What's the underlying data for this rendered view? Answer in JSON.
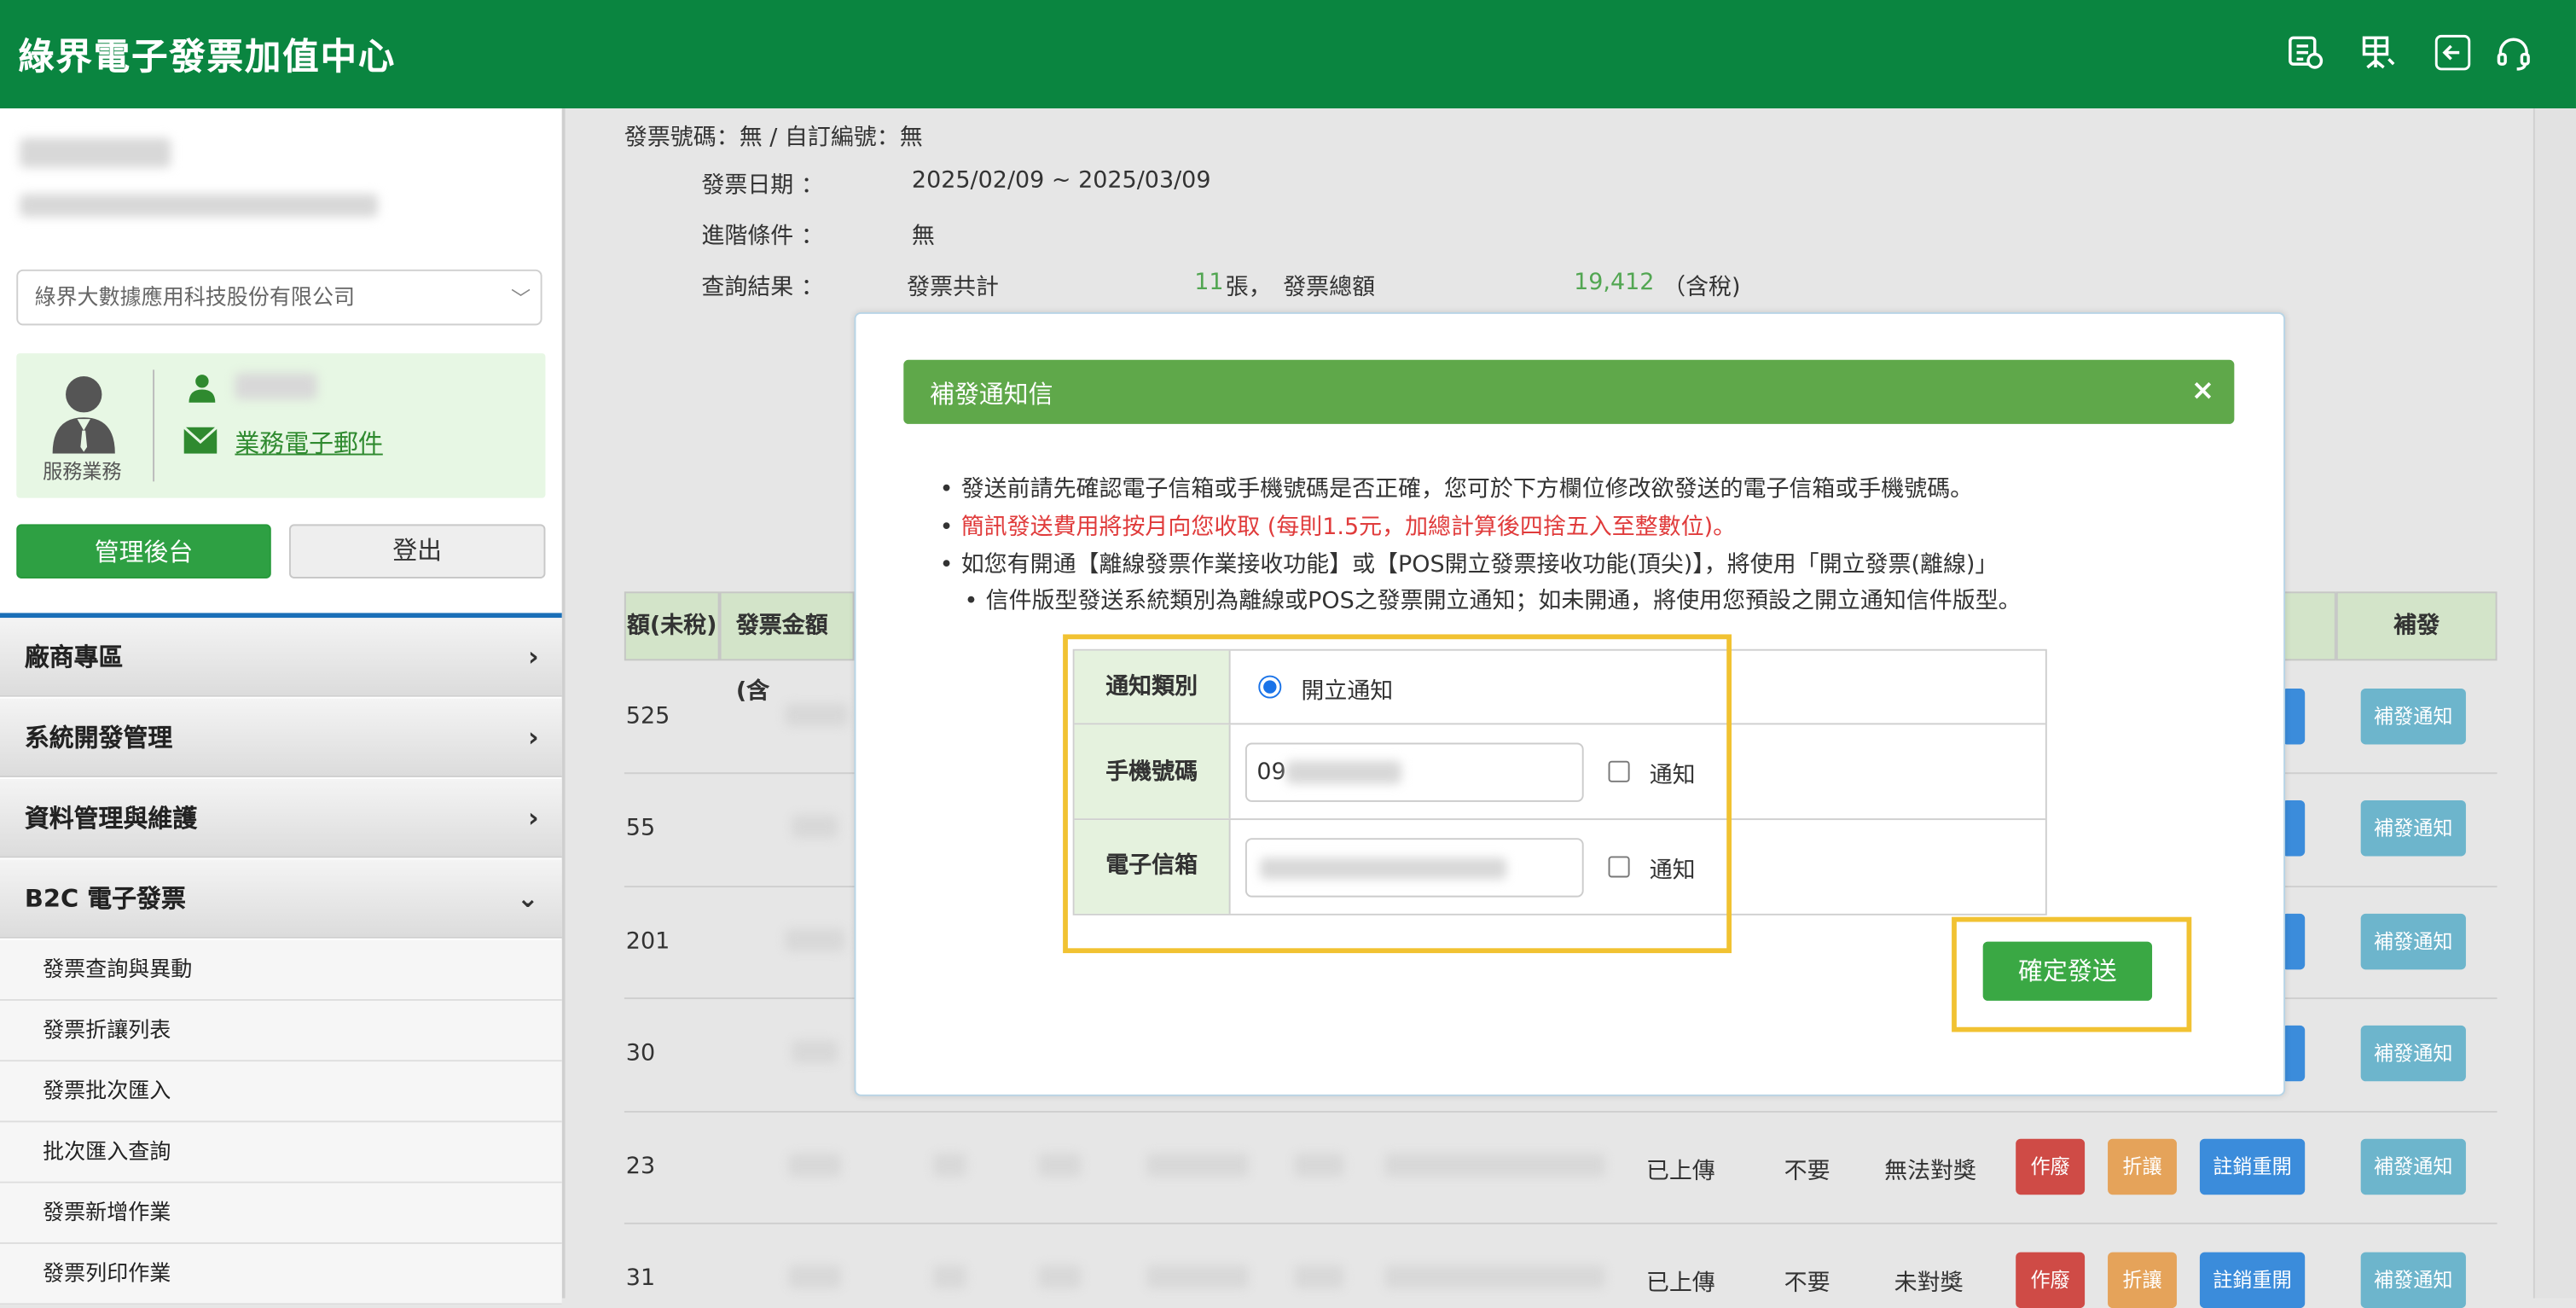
{
  "app": {
    "title": "綠界電子發票加值中心",
    "header_icons": [
      "invoice-chat-icon",
      "font-size-icon",
      "back-arrow-icon",
      "headset-icon"
    ]
  },
  "sidebar": {
    "company_select_value": "綠界大數據應用科技股份有限公司",
    "agent_role": "服務業務",
    "agent_email_link": "業務電子郵件",
    "admin_button": "管理後台",
    "logout_button": "登出",
    "nav": [
      {
        "label": "廠商專區"
      },
      {
        "label": "系統開發管理"
      },
      {
        "label": "資料管理與維護"
      },
      {
        "label": "B2C 電子發票"
      }
    ],
    "sub_items": [
      "發票查詢與異動",
      "發票折讓列表",
      "發票批次匯入",
      "批次匯入查詢",
      "發票新增作業",
      "發票列印作業"
    ]
  },
  "query_summary": {
    "invoice_no_line": "發票號碼：無 / 自訂編號：無",
    "date_label": "發票日期 ：",
    "date_value": "2025/02/09 ~ 2025/03/09",
    "advanced_label": "進階條件 ：",
    "advanced_value": "無",
    "result_label": "查詢結果 ：",
    "total_count_label": "發票共計",
    "total_count": "11",
    "count_unit": "張，",
    "total_amount_label": "發票總額",
    "total_amount": "19,412",
    "tax_note": "（含稅)"
  },
  "table": {
    "headers": [
      "額(未稅)",
      "發票金額(含",
      "補發"
    ],
    "rows": [
      {
        "partial": "525",
        "resend": "補發通知"
      },
      {
        "partial": "55",
        "resend": "補發通知"
      },
      {
        "partial": "201",
        "resend": "補發通知"
      },
      {
        "partial": "30",
        "resend": "補發通知"
      },
      {
        "partial": "23",
        "upload": "已上傳",
        "need": "不要",
        "prize": "無法對獎",
        "void": "作廢",
        "allow": "折讓",
        "cancel": "註銷重開",
        "resend": "補發通知"
      },
      {
        "partial": "31",
        "upload": "已上傳",
        "need": "不要",
        "prize": "未對獎",
        "void": "作廢",
        "allow": "折讓",
        "cancel": "註銷重開",
        "resend": "補發通知"
      }
    ]
  },
  "modal": {
    "title": "補發通知信",
    "close": "×",
    "bullets": [
      "發送前請先確認電子信箱或手機號碼是否正確，您可於下方欄位修改欲發送的電子信箱或手機號碼。",
      "簡訊發送費用將按月向您收取 (每則1.5元，加總計算後四捨五入至整數位)。",
      "如您有開通【離線發票作業接收功能】或【POS開立發票接收功能(頂尖)】，將使用「開立發票(離線)」",
      "信件版型發送系統類別為離線或POS之發票開立通知；如未開通，將使用您預設之開立通知信件版型。"
    ],
    "form": {
      "type_label": "通知類別",
      "type_value": "開立通知",
      "phone_label": "手機號碼",
      "phone_value": "09",
      "phone_notify": "通知",
      "email_label": "電子信箱",
      "email_notify": "通知"
    },
    "submit": "確定發送"
  },
  "colors": {
    "header": "#0a8540",
    "accent_green": "#2ea043",
    "modal_head": "#5fa84a",
    "highlight": "#f1c232"
  }
}
